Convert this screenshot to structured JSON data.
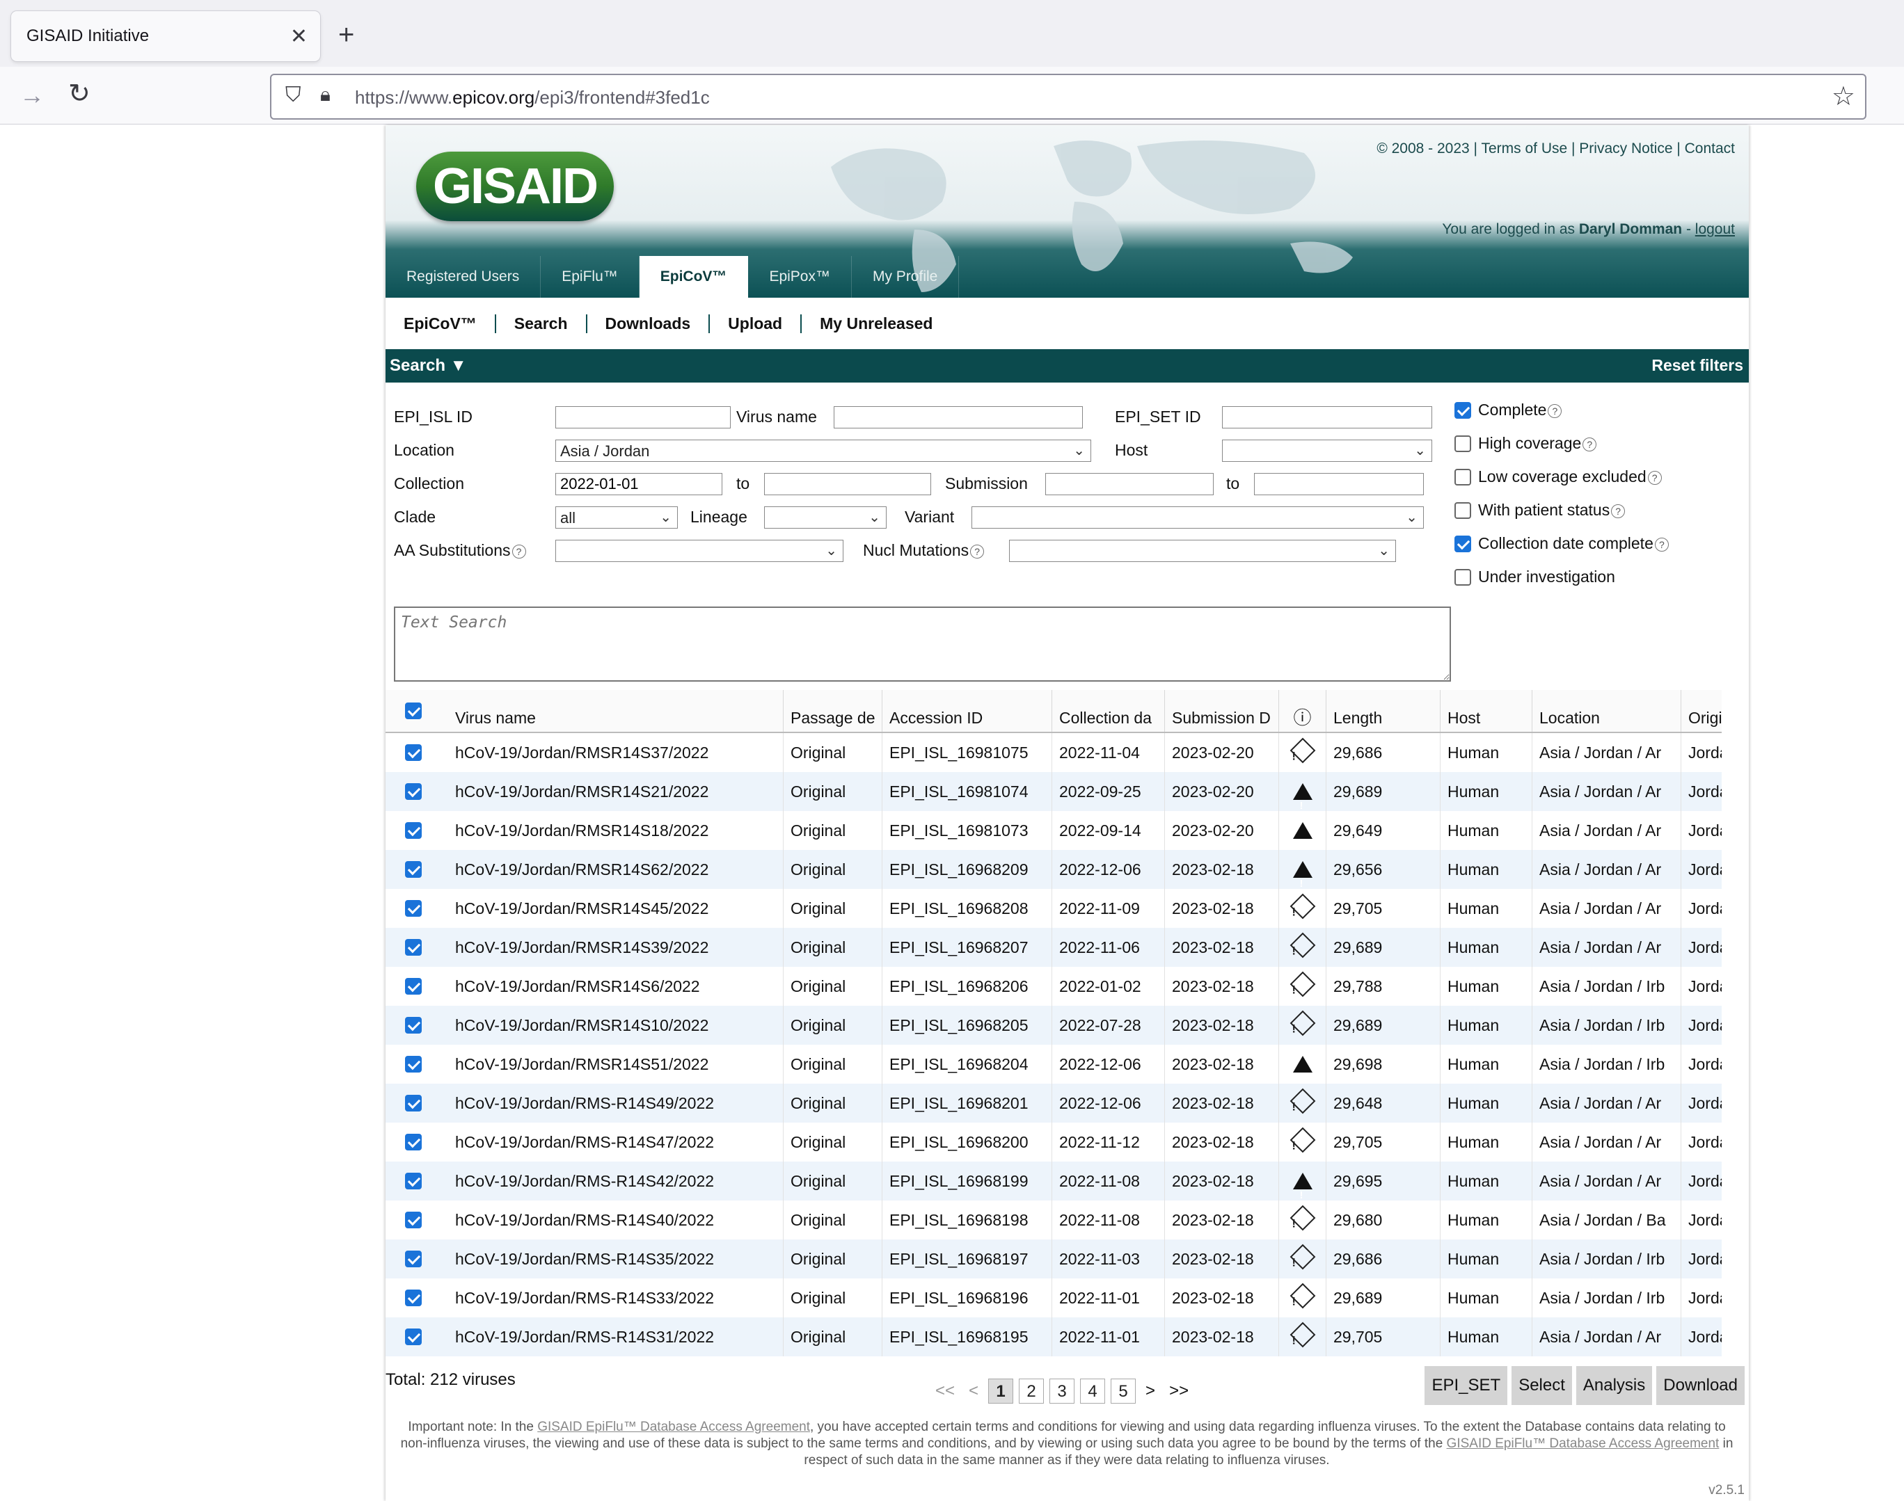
{
  "browser": {
    "tab_title": "GISAID Initiative",
    "url_prefix": "https://www.",
    "url_domain": "epicov.org",
    "url_path": "/epi3/frontend#3fed1c"
  },
  "header": {
    "logo_text": "GISAID",
    "copyright": "© 2008 - 2023",
    "links": [
      "Terms of Use",
      "Privacy Notice",
      "Contact"
    ],
    "login_prefix": "You are logged in as",
    "user": "Daryl Domman",
    "logout": "logout"
  },
  "main_nav": [
    "Registered Users",
    "EpiFlu™",
    "EpiCoV™",
    "EpiPox™",
    "My Profile"
  ],
  "main_nav_active": "EpiCoV™",
  "sub_nav": [
    "EpiCoV™",
    "Search",
    "Downloads",
    "Upload",
    "My Unreleased"
  ],
  "search_bar": {
    "label": "Search ▼",
    "reset": "Reset filters"
  },
  "form": {
    "epi_isl_label": "EPI_ISL ID",
    "virus_name_label": "Virus name",
    "epi_set_label": "EPI_SET ID",
    "location_label": "Location",
    "location_value": "Asia / Jordan",
    "host_label": "Host",
    "collection_label": "Collection",
    "collection_from": "2022-01-01",
    "to_label": "to",
    "submission_label": "Submission",
    "clade_label": "Clade",
    "clade_value": "all",
    "lineage_label": "Lineage",
    "variant_label": "Variant",
    "aa_label": "AA Substitutions",
    "nucl_label": "Nucl Mutations",
    "text_search_placeholder": "Text Search"
  },
  "filters": [
    {
      "label": "Complete",
      "checked": true,
      "help": true
    },
    {
      "label": "High coverage",
      "checked": false,
      "help": true
    },
    {
      "label": "Low coverage excluded",
      "checked": false,
      "help": true
    },
    {
      "label": "With patient status",
      "checked": false,
      "help": true
    },
    {
      "label": "Collection date complete",
      "checked": true,
      "help": true
    },
    {
      "label": "Under investigation",
      "checked": false,
      "help": false
    }
  ],
  "table": {
    "headers": [
      "Virus name",
      "Passage de",
      "Accession ID",
      "Collection da",
      "Submission D",
      "ⓘ",
      "Length",
      "Host",
      "Location",
      "Originating"
    ],
    "rows": [
      [
        "hCoV-19/Jordan/RMSR14S37/2022",
        "Original",
        "EPI_ISL_16981075",
        "2022-11-04",
        "2023-02-20",
        "diamond",
        "29,686",
        "Human",
        "Asia / Jordan / Ar",
        "Jordan Roy"
      ],
      [
        "hCoV-19/Jordan/RMSR14S21/2022",
        "Original",
        "EPI_ISL_16981074",
        "2022-09-25",
        "2023-02-20",
        "triangle",
        "29,689",
        "Human",
        "Asia / Jordan / Ar",
        "Jordan Roy"
      ],
      [
        "hCoV-19/Jordan/RMSR14S18/2022",
        "Original",
        "EPI_ISL_16981073",
        "2022-09-14",
        "2023-02-20",
        "triangle",
        "29,649",
        "Human",
        "Asia / Jordan / Ar",
        "Jordan Roy"
      ],
      [
        "hCoV-19/Jordan/RMSR14S62/2022",
        "Original",
        "EPI_ISL_16968209",
        "2022-12-06",
        "2023-02-18",
        "triangle",
        "29,656",
        "Human",
        "Asia / Jordan / Ar",
        "Jordan Roy"
      ],
      [
        "hCoV-19/Jordan/RMSR14S45/2022",
        "Original",
        "EPI_ISL_16968208",
        "2022-11-09",
        "2023-02-18",
        "diamond",
        "29,705",
        "Human",
        "Asia / Jordan / Ar",
        "Jordan Roy"
      ],
      [
        "hCoV-19/Jordan/RMSR14S39/2022",
        "Original",
        "EPI_ISL_16968207",
        "2022-11-06",
        "2023-02-18",
        "diamond",
        "29,689",
        "Human",
        "Asia / Jordan / Ar",
        "Jordan Roy"
      ],
      [
        "hCoV-19/Jordan/RMSR14S6/2022",
        "Original",
        "EPI_ISL_16968206",
        "2022-01-02",
        "2023-02-18",
        "diamond",
        "29,788",
        "Human",
        "Asia / Jordan / Irb",
        "Jordan Roy"
      ],
      [
        "hCoV-19/Jordan/RMSR14S10/2022",
        "Original",
        "EPI_ISL_16968205",
        "2022-07-28",
        "2023-02-18",
        "diamond",
        "29,689",
        "Human",
        "Asia / Jordan / Irb",
        "Jordan Roy"
      ],
      [
        "hCoV-19/Jordan/RMSR14S51/2022",
        "Original",
        "EPI_ISL_16968204",
        "2022-12-06",
        "2023-02-18",
        "triangle",
        "29,698",
        "Human",
        "Asia / Jordan / Irb",
        "Jordan Roy"
      ],
      [
        "hCoV-19/Jordan/RMS-R14S49/2022",
        "Original",
        "EPI_ISL_16968201",
        "2022-12-06",
        "2023-02-18",
        "diamond",
        "29,648",
        "Human",
        "Asia / Jordan / Ar",
        "Jordan Roy"
      ],
      [
        "hCoV-19/Jordan/RMS-R14S47/2022",
        "Original",
        "EPI_ISL_16968200",
        "2022-11-12",
        "2023-02-18",
        "diamond",
        "29,705",
        "Human",
        "Asia / Jordan / Ar",
        "Jordan Roy"
      ],
      [
        "hCoV-19/Jordan/RMS-R14S42/2022",
        "Original",
        "EPI_ISL_16968199",
        "2022-11-08",
        "2023-02-18",
        "triangle",
        "29,695",
        "Human",
        "Asia / Jordan / Ar",
        "Jordan Roy"
      ],
      [
        "hCoV-19/Jordan/RMS-R14S40/2022",
        "Original",
        "EPI_ISL_16968198",
        "2022-11-08",
        "2023-02-18",
        "diamond",
        "29,680",
        "Human",
        "Asia / Jordan / Ba",
        "Jordan Roy"
      ],
      [
        "hCoV-19/Jordan/RMS-R14S35/2022",
        "Original",
        "EPI_ISL_16968197",
        "2022-11-03",
        "2023-02-18",
        "diamond",
        "29,686",
        "Human",
        "Asia / Jordan / Irb",
        "Jordan Roy"
      ],
      [
        "hCoV-19/Jordan/RMS-R14S33/2022",
        "Original",
        "EPI_ISL_16968196",
        "2022-11-01",
        "2023-02-18",
        "diamond",
        "29,689",
        "Human",
        "Asia / Jordan / Irb",
        "Jordan Roy"
      ],
      [
        "hCoV-19/Jordan/RMS-R14S31/2022",
        "Original",
        "EPI_ISL_16968195",
        "2022-11-01",
        "2023-02-18",
        "diamond",
        "29,705",
        "Human",
        "Asia / Jordan / Ar",
        "Jordan Roy"
      ]
    ]
  },
  "footer": {
    "total": "Total: 212 viruses",
    "pager_first": "<<",
    "pager_prev": "<",
    "pages": [
      "1",
      "2",
      "3",
      "4",
      "5"
    ],
    "current_page": "1",
    "pager_next": ">",
    "pager_last": ">>",
    "buttons": [
      "EPI_SET",
      "Select",
      "Analysis",
      "Download"
    ],
    "note_1": "Important note: In the ",
    "note_link_1": "GISAID EpiFlu™ Database Access Agreement",
    "note_2": ", you have accepted certain terms and conditions for viewing and using data regarding influenza viruses. To the extent the Database contains data relating to non-influenza viruses, the viewing and use of these data is subject to the same terms and conditions, and by viewing or using such data you agree to be bound by the terms of the ",
    "note_link_2": "GISAID EpiFlu™ Database Access Agreement",
    "note_3": " in respect of such data in the same manner as if they were data relating to influenza viruses.",
    "version": "v2.5.1"
  },
  "colors": {
    "brand_dark": "#0b4a4d",
    "checkbox_blue": "#1a73d9",
    "row_alt": "#edf4fb"
  }
}
